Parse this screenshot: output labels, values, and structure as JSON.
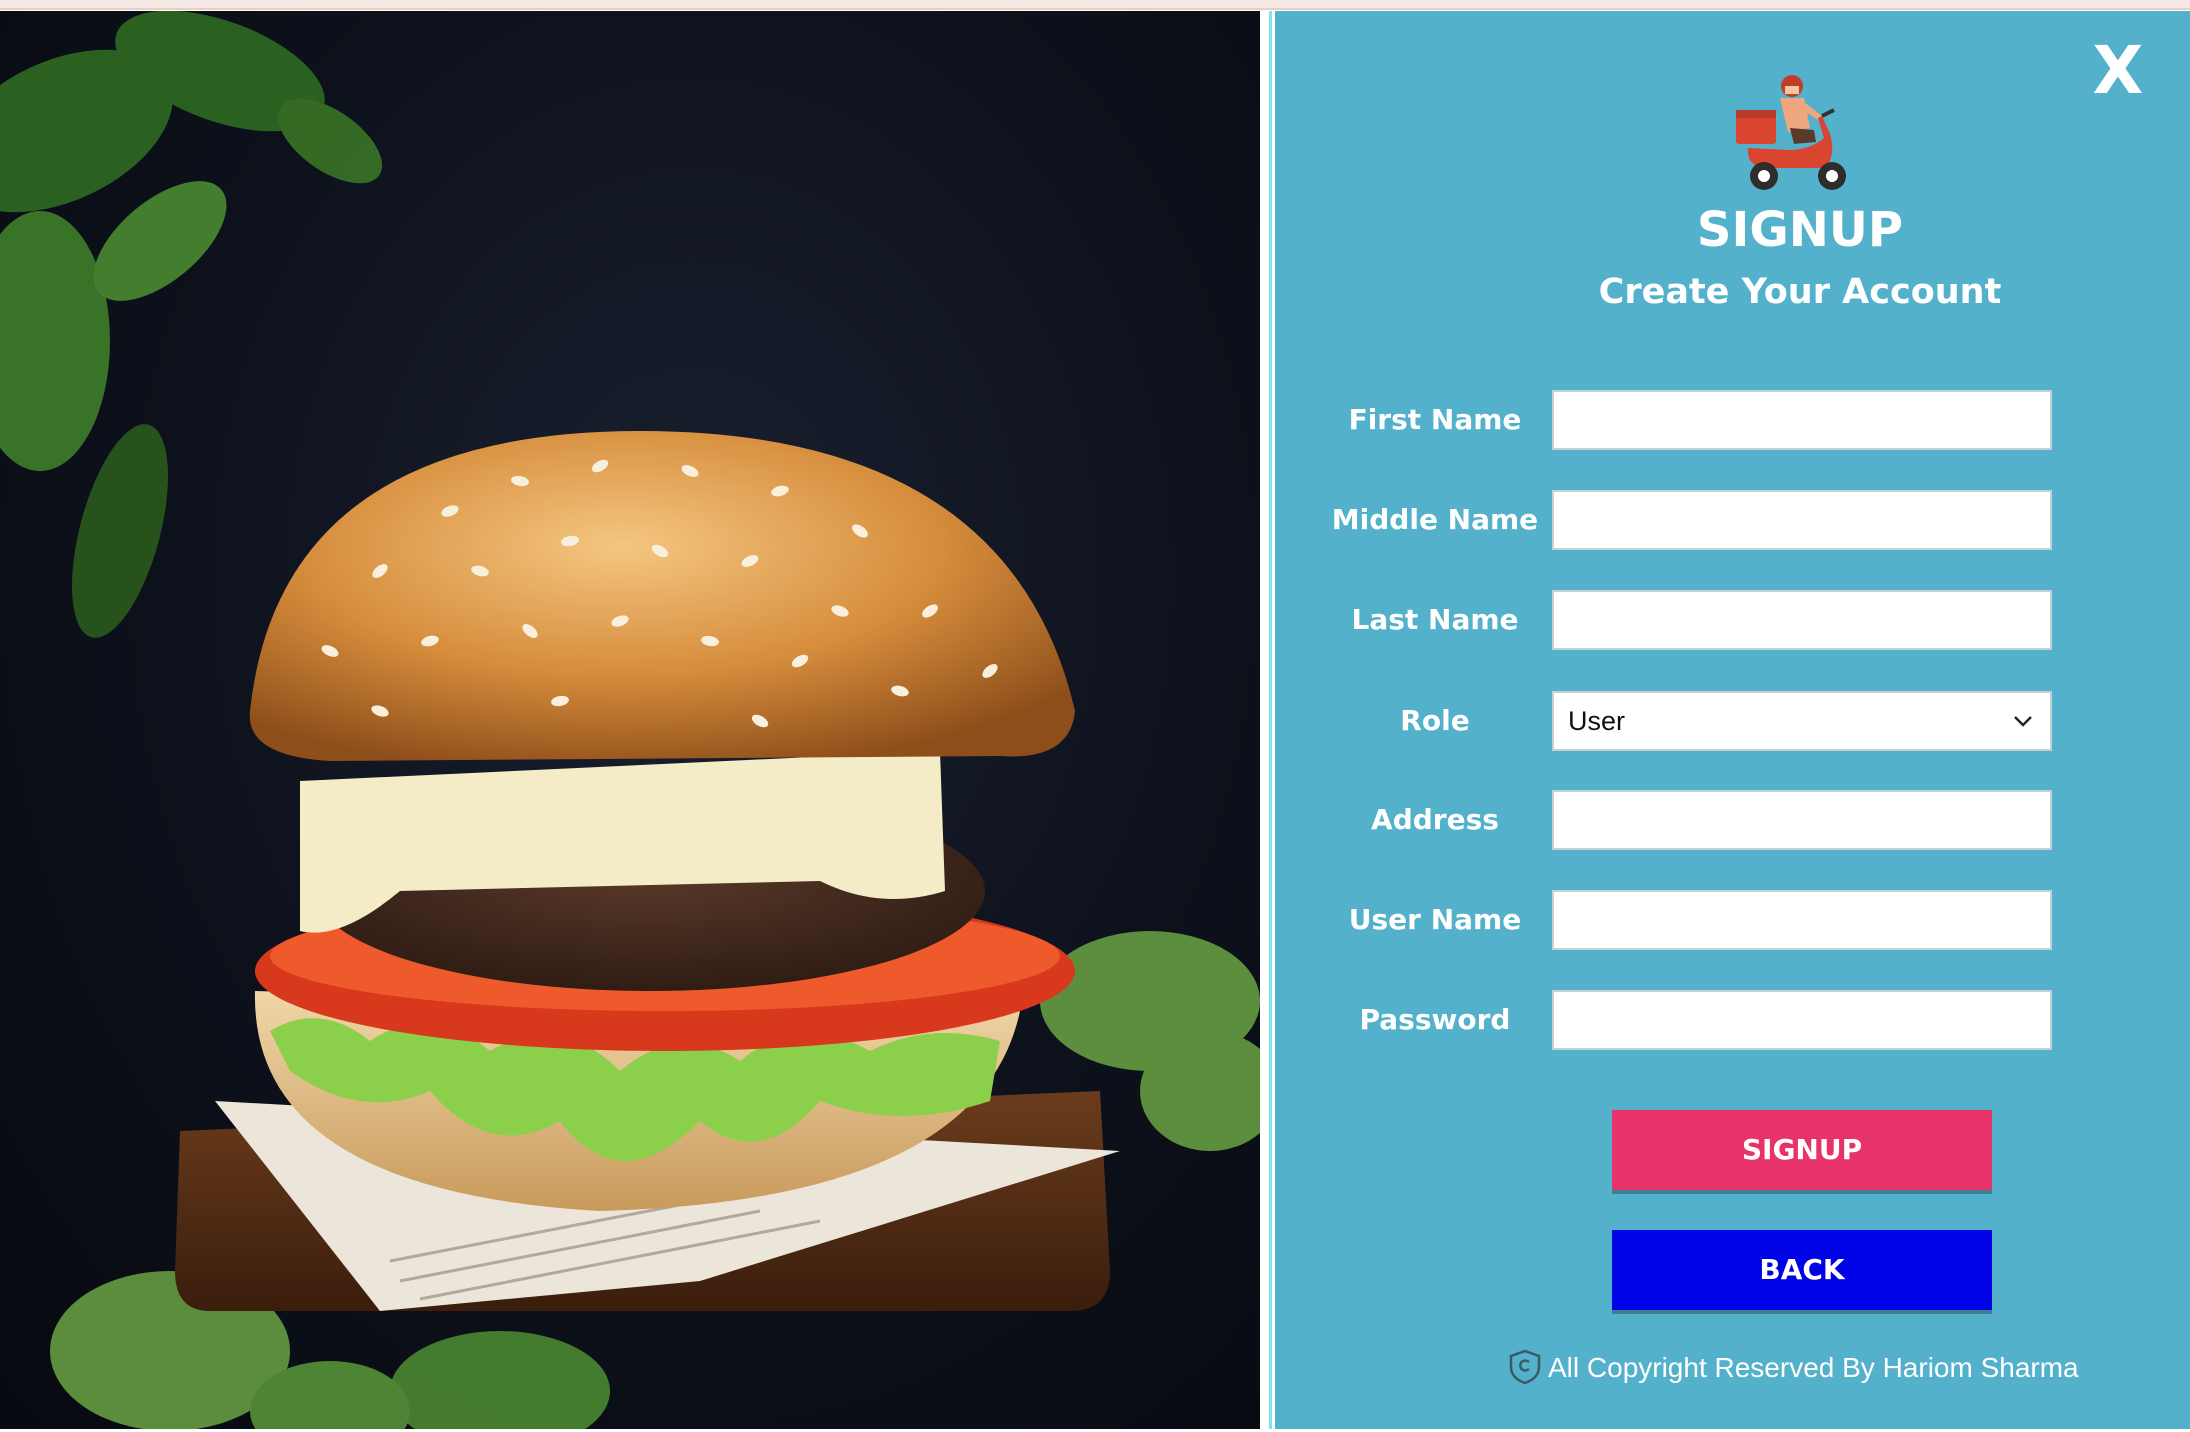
{
  "window": {
    "close_label": "X"
  },
  "header": {
    "logo_icon": "delivery-scooter-icon",
    "title": "SIGNUP",
    "subtitle": "Create Your Account"
  },
  "form": {
    "fields": [
      {
        "label": "First Name",
        "value": ""
      },
      {
        "label": "Middle Name",
        "value": ""
      },
      {
        "label": "Last Name",
        "value": ""
      },
      {
        "label": "Role",
        "value": "User"
      },
      {
        "label": "Address",
        "value": ""
      },
      {
        "label": "User Name",
        "value": ""
      },
      {
        "label": "Password",
        "value": ""
      }
    ]
  },
  "buttons": {
    "signup_label": "SIGNUP",
    "back_label": "BACK"
  },
  "footer": {
    "copyright_icon": "copyright-shield-icon",
    "copyright_text": "All Copyright Reserved By Hariom Sharma"
  },
  "colors": {
    "panel_bg": "#54b1cc",
    "signup_button": "#e8336a",
    "back_button": "#0003e6",
    "text": "#ffffff"
  }
}
